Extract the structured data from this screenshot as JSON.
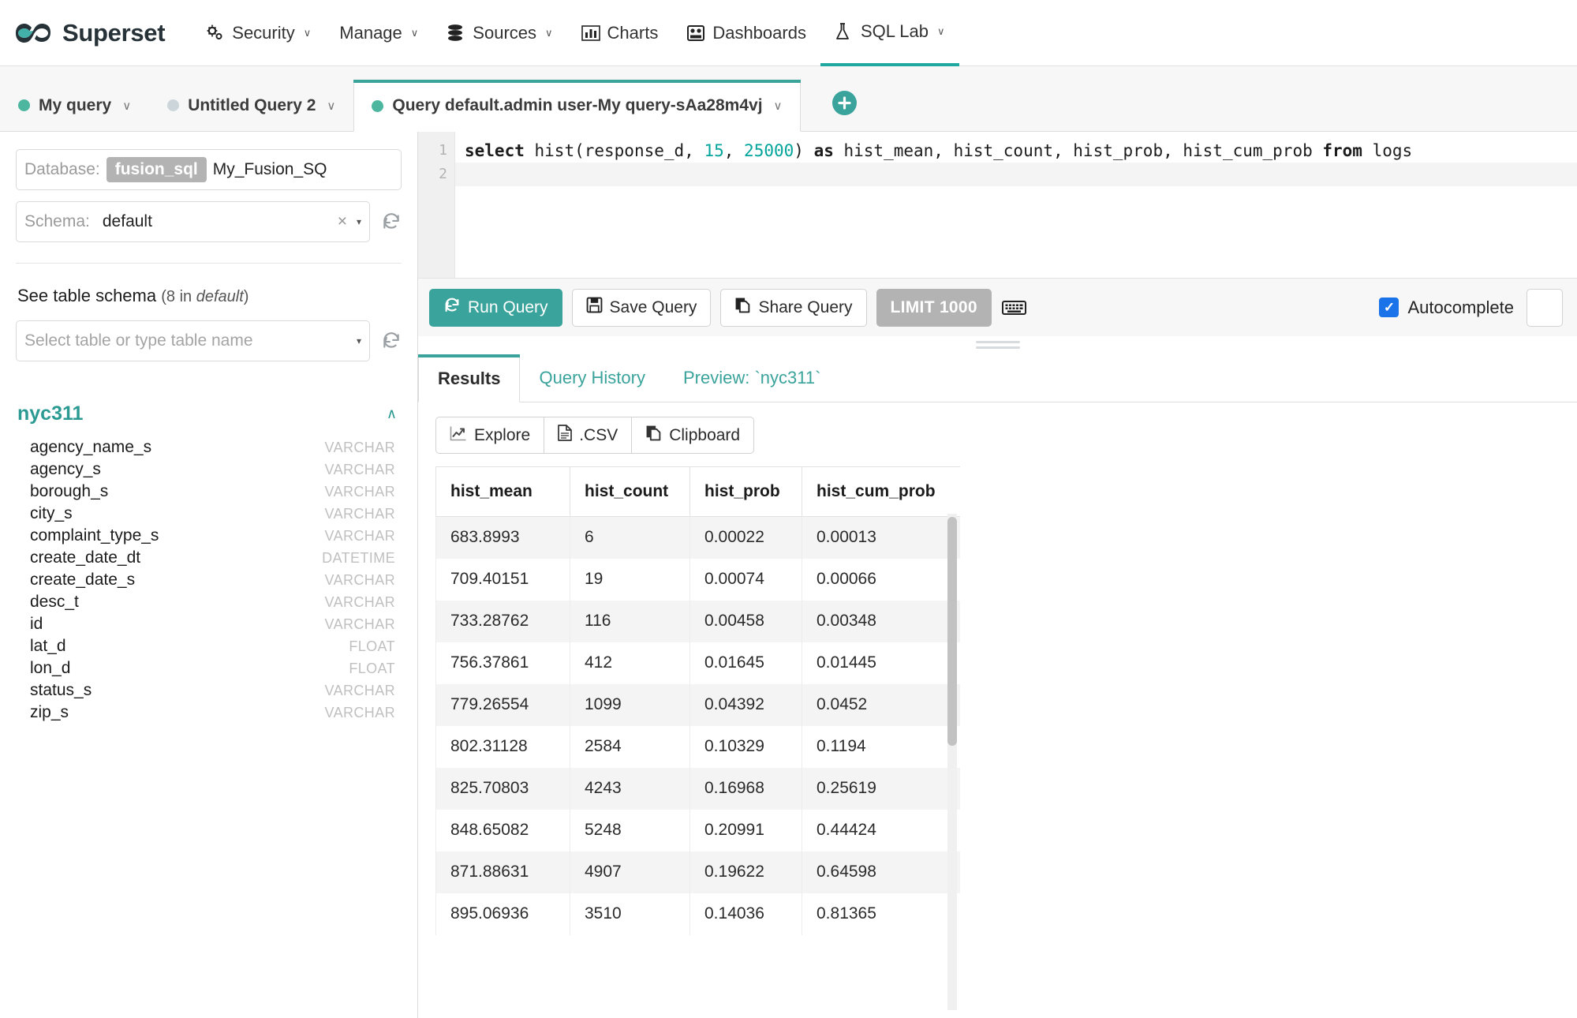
{
  "navbar": {
    "brand": "Superset",
    "brand_logo_icon": "infinity-logo-icon",
    "items": [
      {
        "label": "Security",
        "icon": "gears-icon",
        "caret": "∨",
        "active": false
      },
      {
        "label": "Manage",
        "icon": "",
        "caret": "∨",
        "active": false
      },
      {
        "label": "Sources",
        "icon": "database-icon",
        "caret": "∨",
        "active": false
      },
      {
        "label": "Charts",
        "icon": "bar-chart-icon",
        "caret": "",
        "active": false
      },
      {
        "label": "Dashboards",
        "icon": "dashboard-icon",
        "caret": "",
        "active": false
      },
      {
        "label": "SQL Lab",
        "icon": "flask-icon",
        "caret": "∨",
        "active": true
      }
    ]
  },
  "tabbar": {
    "tabs": [
      {
        "label": "My query",
        "status": "green",
        "caret": "∨",
        "active": false
      },
      {
        "label": "Untitled Query 2",
        "status": "grey",
        "caret": "∨",
        "active": false
      },
      {
        "label": "Query default.admin user-My query-sAa28m4vj",
        "status": "green",
        "caret": "∨",
        "active": true
      }
    ],
    "add_label": "+"
  },
  "left": {
    "database": {
      "label": "Database:",
      "pill": "fusion_sql",
      "value": "My_Fusion_SQ"
    },
    "schema": {
      "label": "Schema:",
      "value": "default",
      "clear": "×",
      "caret": "▾"
    },
    "table_schema_heading": "See table schema",
    "table_schema_count": "(8 in ",
    "table_schema_schema": "default",
    "table_schema_close": ")",
    "table_select_placeholder": "Select table or type table name",
    "table_select_caret": "▾",
    "table": {
      "name": "nyc311",
      "collapse_caret": "∧",
      "columns": [
        {
          "name": "agency_name_s",
          "type": "VARCHAR"
        },
        {
          "name": "agency_s",
          "type": "VARCHAR"
        },
        {
          "name": "borough_s",
          "type": "VARCHAR"
        },
        {
          "name": "city_s",
          "type": "VARCHAR"
        },
        {
          "name": "complaint_type_s",
          "type": "VARCHAR"
        },
        {
          "name": "create_date_dt",
          "type": "DATETIME"
        },
        {
          "name": "create_date_s",
          "type": "VARCHAR"
        },
        {
          "name": "desc_t",
          "type": "VARCHAR"
        },
        {
          "name": "id",
          "type": "VARCHAR"
        },
        {
          "name": "lat_d",
          "type": "FLOAT"
        },
        {
          "name": "lon_d",
          "type": "FLOAT"
        },
        {
          "name": "status_s",
          "type": "VARCHAR"
        },
        {
          "name": "zip_s",
          "type": "VARCHAR"
        }
      ]
    }
  },
  "editor": {
    "line_numbers": [
      "1",
      "2"
    ],
    "sql": "select hist(response_d, 15, 25000) as hist_mean, hist_count, hist_prob, hist_cum_prob from logs",
    "tokens": [
      {
        "t": "select ",
        "k": "kw"
      },
      {
        "t": "hist(response_d, ",
        "k": "txt"
      },
      {
        "t": "15",
        "k": "num"
      },
      {
        "t": ", ",
        "k": "txt"
      },
      {
        "t": "25000",
        "k": "num"
      },
      {
        "t": ") ",
        "k": "txt"
      },
      {
        "t": "as",
        "k": "kw"
      },
      {
        "t": " hist_mean, hist_count, hist_prob, hist_cum_prob ",
        "k": "txt"
      },
      {
        "t": "from",
        "k": "kw"
      },
      {
        "t": " logs",
        "k": "txt"
      }
    ]
  },
  "toolbar": {
    "run_label": "Run Query",
    "run_icon": "refresh-icon",
    "save_label": "Save Query",
    "save_icon": "floppy-icon",
    "share_label": "Share Query",
    "share_icon": "copy-icon",
    "limit_label": "LIMIT 1000",
    "keyboard_icon": "keyboard-icon",
    "autocomplete_label": "Autocomplete",
    "autocomplete_checked": "✓"
  },
  "results": {
    "tabs": [
      {
        "label": "Results",
        "active": true
      },
      {
        "label": "Query History",
        "active": false
      },
      {
        "label": "Preview: `nyc311`",
        "active": false
      }
    ],
    "actions": [
      {
        "label": "Explore",
        "icon": "line-chart-icon"
      },
      {
        "label": ".CSV",
        "icon": "file-icon"
      },
      {
        "label": "Clipboard",
        "icon": "copy-icon"
      }
    ],
    "columns": [
      "hist_mean",
      "hist_count",
      "hist_prob",
      "hist_cum_prob"
    ],
    "rows": [
      [
        "683.8993",
        "6",
        "0.00022",
        "0.00013"
      ],
      [
        "709.40151",
        "19",
        "0.00074",
        "0.00066"
      ],
      [
        "733.28762",
        "116",
        "0.00458",
        "0.00348"
      ],
      [
        "756.37861",
        "412",
        "0.01645",
        "0.01445"
      ],
      [
        "779.26554",
        "1099",
        "0.04392",
        "0.0452"
      ],
      [
        "802.31128",
        "2584",
        "0.10329",
        "0.1194"
      ],
      [
        "825.70803",
        "4243",
        "0.16968",
        "0.25619"
      ],
      [
        "848.65082",
        "5248",
        "0.20991",
        "0.44424"
      ],
      [
        "871.88631",
        "4907",
        "0.19622",
        "0.64598"
      ],
      [
        "895.06936",
        "3510",
        "0.14036",
        "0.81365"
      ]
    ]
  },
  "colors": {
    "accent": "#3aa39b",
    "accent_dark": "#20a7a0",
    "checkbox_blue": "#1a73e8",
    "grey_pill": "#b3b3b3",
    "dot_green": "#4cb69e",
    "dot_grey": "#ccd6da"
  }
}
